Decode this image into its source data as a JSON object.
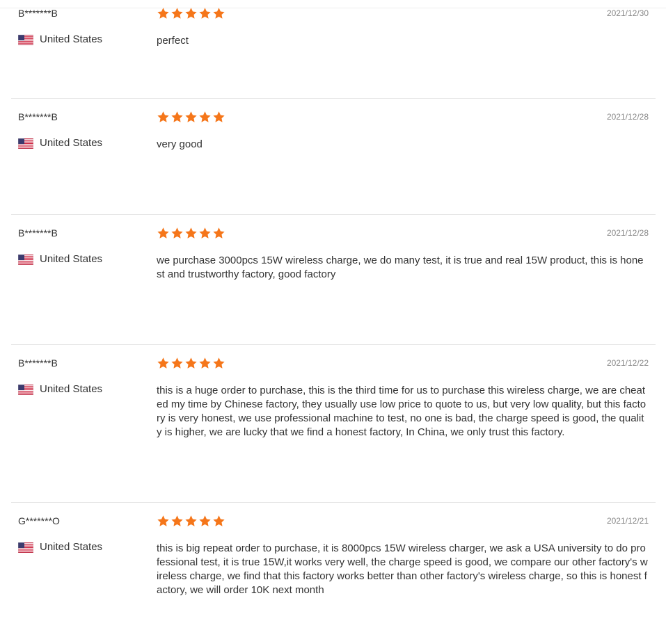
{
  "colors": {
    "star": "#f5761a",
    "flag_red": "#c8102e",
    "flag_blue": "#3c3b6e"
  },
  "reviews": [
    {
      "reviewer": "B*******B",
      "country": "United States",
      "country_flag_icon": "us-flag-icon",
      "rating": 5,
      "date": "2021/12/30",
      "content": "perfect"
    },
    {
      "reviewer": "B*******B",
      "country": "United States",
      "country_flag_icon": "us-flag-icon",
      "rating": 5,
      "date": "2021/12/28",
      "content": "very good"
    },
    {
      "reviewer": "B*******B",
      "country": "United States",
      "country_flag_icon": "us-flag-icon",
      "rating": 5,
      "date": "2021/12/28",
      "content": "we purchase 3000pcs 15W wireless charge, we do many test, it is true and real 15W product, this is honest and trustworthy factory, good factory"
    },
    {
      "reviewer": "B*******B",
      "country": "United States",
      "country_flag_icon": "us-flag-icon",
      "rating": 5,
      "date": "2021/12/22",
      "content": "this is a huge order to purchase, this is the third time for us to purchase this wireless charge, we are cheated my time by Chinese factory, they usually use low price to quote to us, but very low quality, but this factory is very honest, we use professional machine to test, no one is bad, the charge speed is good, the quality is higher, we are lucky that we find a honest factory, In China, we only trust this factory."
    },
    {
      "reviewer": "G*******O",
      "country": "United States",
      "country_flag_icon": "us-flag-icon",
      "rating": 5,
      "date": "2021/12/21",
      "content": "this is big repeat order to purchase, it is 8000pcs 15W wireless charger, we ask a USA university to do professional test, it is true 15W,it works very well, the charge speed is good, we compare our other factory's wireless charge, we find that this factory works better than other factory's wireless charge, so this is honest factory, we will order 10K next month"
    }
  ]
}
